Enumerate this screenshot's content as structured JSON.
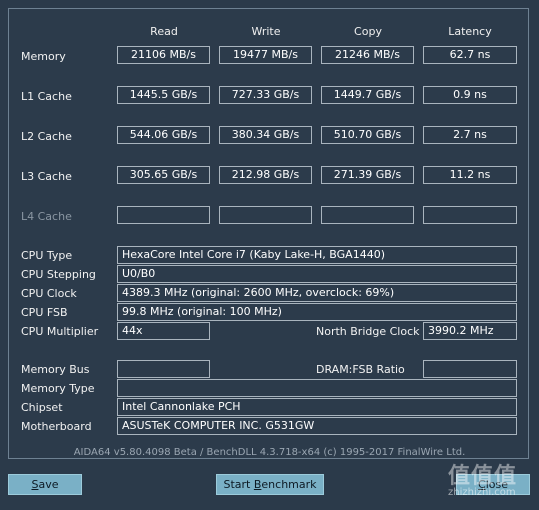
{
  "headers": [
    "Read",
    "Write",
    "Copy",
    "Latency"
  ],
  "bench_rows": [
    {
      "label": "Memory",
      "read": "21106 MB/s",
      "write": "19477 MB/s",
      "copy": "21246 MB/s",
      "latency": "62.7 ns"
    },
    {
      "label": "L1 Cache",
      "read": "1445.5 GB/s",
      "write": "727.33 GB/s",
      "copy": "1449.7 GB/s",
      "latency": "0.9 ns"
    },
    {
      "label": "L2 Cache",
      "read": "544.06 GB/s",
      "write": "380.34 GB/s",
      "copy": "510.70 GB/s",
      "latency": "2.7 ns"
    },
    {
      "label": "L3 Cache",
      "read": "305.65 GB/s",
      "write": "212.98 GB/s",
      "copy": "271.39 GB/s",
      "latency": "11.2 ns"
    },
    {
      "label": "L4 Cache",
      "read": "",
      "write": "",
      "copy": "",
      "latency": ""
    }
  ],
  "info": {
    "cpu_type": {
      "label": "CPU Type",
      "value": "HexaCore Intel Core i7  (Kaby Lake-H, BGA1440)"
    },
    "cpu_stepping": {
      "label": "CPU Stepping",
      "value": "U0/B0"
    },
    "cpu_clock": {
      "label": "CPU Clock",
      "value": "4389.3 MHz  (original: 2600 MHz, overclock: 69%)"
    },
    "cpu_fsb": {
      "label": "CPU FSB",
      "value": "99.8 MHz  (original: 100 MHz)"
    },
    "cpu_multiplier": {
      "label": "CPU Multiplier",
      "value": "44x"
    },
    "north_bridge_clock": {
      "label": "North Bridge Clock",
      "value": "3990.2 MHz"
    },
    "memory_bus": {
      "label": "Memory Bus",
      "value": ""
    },
    "dram_fsb_ratio": {
      "label": "DRAM:FSB Ratio",
      "value": ""
    },
    "memory_type": {
      "label": "Memory Type",
      "value": ""
    },
    "chipset": {
      "label": "Chipset",
      "value": "Intel Cannonlake PCH"
    },
    "motherboard": {
      "label": "Motherboard",
      "value": "ASUSTeK COMPUTER INC. G531GW"
    }
  },
  "footer": "AIDA64 v5.80.4098 Beta / BenchDLL 4.3.718-x64  (c) 1995-2017 FinalWire Ltd.",
  "buttons": {
    "save": {
      "underline": "S",
      "rest": "ave"
    },
    "start": {
      "pre": "Start ",
      "underline": "B",
      "rest": "enchmark"
    },
    "close": {
      "underline": "C",
      "rest": "lose"
    }
  },
  "watermark": {
    "logo": "值值值",
    "site": "zhizhizhi.com"
  }
}
